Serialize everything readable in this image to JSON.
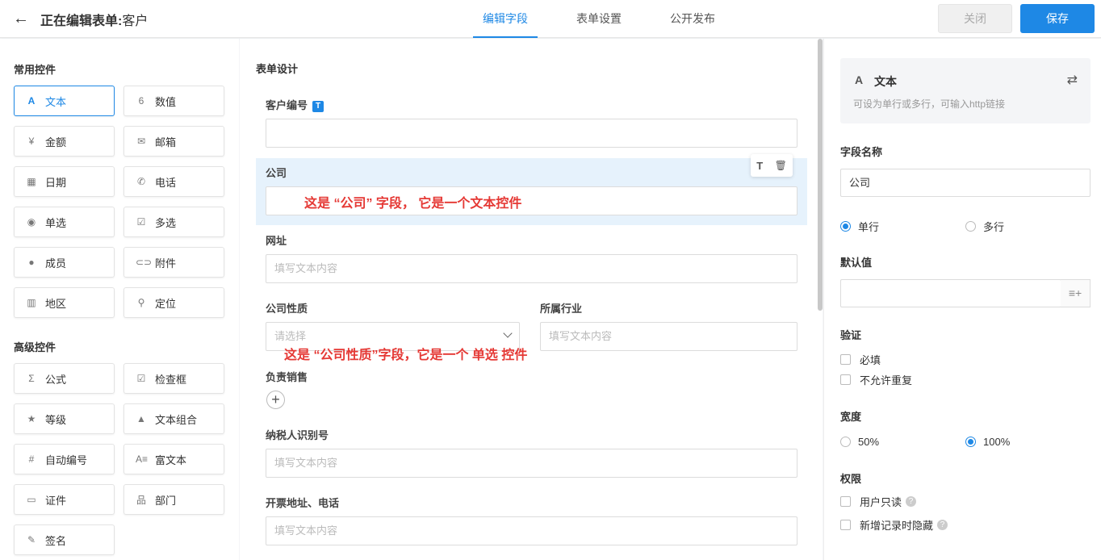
{
  "header": {
    "back_icon": "arrow-left-icon",
    "title_prefix": "正在编辑表单:",
    "title_name": "客户",
    "tabs": [
      {
        "label": "编辑字段",
        "active": true
      },
      {
        "label": "表单设置",
        "active": false
      },
      {
        "label": "公开发布",
        "active": false
      }
    ],
    "close_label": "关闭",
    "save_label": "保存"
  },
  "left": {
    "common_title": "常用控件",
    "advanced_title": "高级控件",
    "common": [
      {
        "label": "文本",
        "icon": "A"
      },
      {
        "label": "数值",
        "icon": "6"
      },
      {
        "label": "金额",
        "icon": "¥"
      },
      {
        "label": "邮箱",
        "icon": "✉"
      },
      {
        "label": "日期",
        "icon": "▦"
      },
      {
        "label": "电话",
        "icon": "✆"
      },
      {
        "label": "单选",
        "icon": "◉"
      },
      {
        "label": "多选",
        "icon": "☑"
      },
      {
        "label": "成员",
        "icon": "●"
      },
      {
        "label": "附件",
        "icon": "⊂⊃"
      },
      {
        "label": "地区",
        "icon": "▥"
      },
      {
        "label": "定位",
        "icon": "⚲"
      }
    ],
    "advanced": [
      {
        "label": "公式",
        "icon": "Σ"
      },
      {
        "label": "检查框",
        "icon": "☑"
      },
      {
        "label": "等级",
        "icon": "★"
      },
      {
        "label": "文本组合",
        "icon": "▲"
      },
      {
        "label": "自动编号",
        "icon": "#"
      },
      {
        "label": "富文本",
        "icon": "A≡"
      },
      {
        "label": "证件",
        "icon": "▭"
      },
      {
        "label": "部门",
        "icon": "品"
      },
      {
        "label": "签名",
        "icon": "✎"
      }
    ]
  },
  "middle": {
    "title": "表单设计",
    "fields": {
      "customer_no": {
        "label": "客户编号",
        "badge": "T",
        "value": ""
      },
      "company": {
        "label": "公司",
        "value": ""
      },
      "website": {
        "label": "网址",
        "placeholder": "填写文本内容"
      },
      "company_type": {
        "label": "公司性质",
        "placeholder": "请选择"
      },
      "industry": {
        "label": "所属行业",
        "placeholder": "填写文本内容"
      },
      "sales": {
        "label": "负责销售",
        "add_icon": "+"
      },
      "tax_id": {
        "label": "纳税人识别号",
        "placeholder": "填写文本内容"
      },
      "invoice": {
        "label": "开票地址、电话",
        "placeholder": "填写文本内容"
      }
    },
    "tools": {
      "text_icon": "T",
      "delete_icon": "🗑"
    },
    "annotations": {
      "company": "这是 “公司” 字段， 它是一个文本控件",
      "company_type": "这是 “公司性质”字段，它是一个 单选 控件"
    }
  },
  "right": {
    "card": {
      "icon": "A",
      "title": "文本",
      "desc": "可设为单行或多行，可输入http链接",
      "swap_icon": "⇄"
    },
    "field_name_label": "字段名称",
    "field_name_value": "公司",
    "line_options": [
      {
        "label": "单行",
        "checked": true
      },
      {
        "label": "多行",
        "checked": false
      }
    ],
    "default_label": "默认值",
    "default_icon": "≡+",
    "validate_label": "验证",
    "validate_options": [
      "必填",
      "不允许重复"
    ],
    "width_label": "宽度",
    "width_options": [
      {
        "label": "50%",
        "checked": false
      },
      {
        "label": "100%",
        "checked": true
      }
    ],
    "perm_label": "权限",
    "perm_options": [
      "用户只读",
      "新增记录时隐藏"
    ],
    "help_icon": "?"
  }
}
